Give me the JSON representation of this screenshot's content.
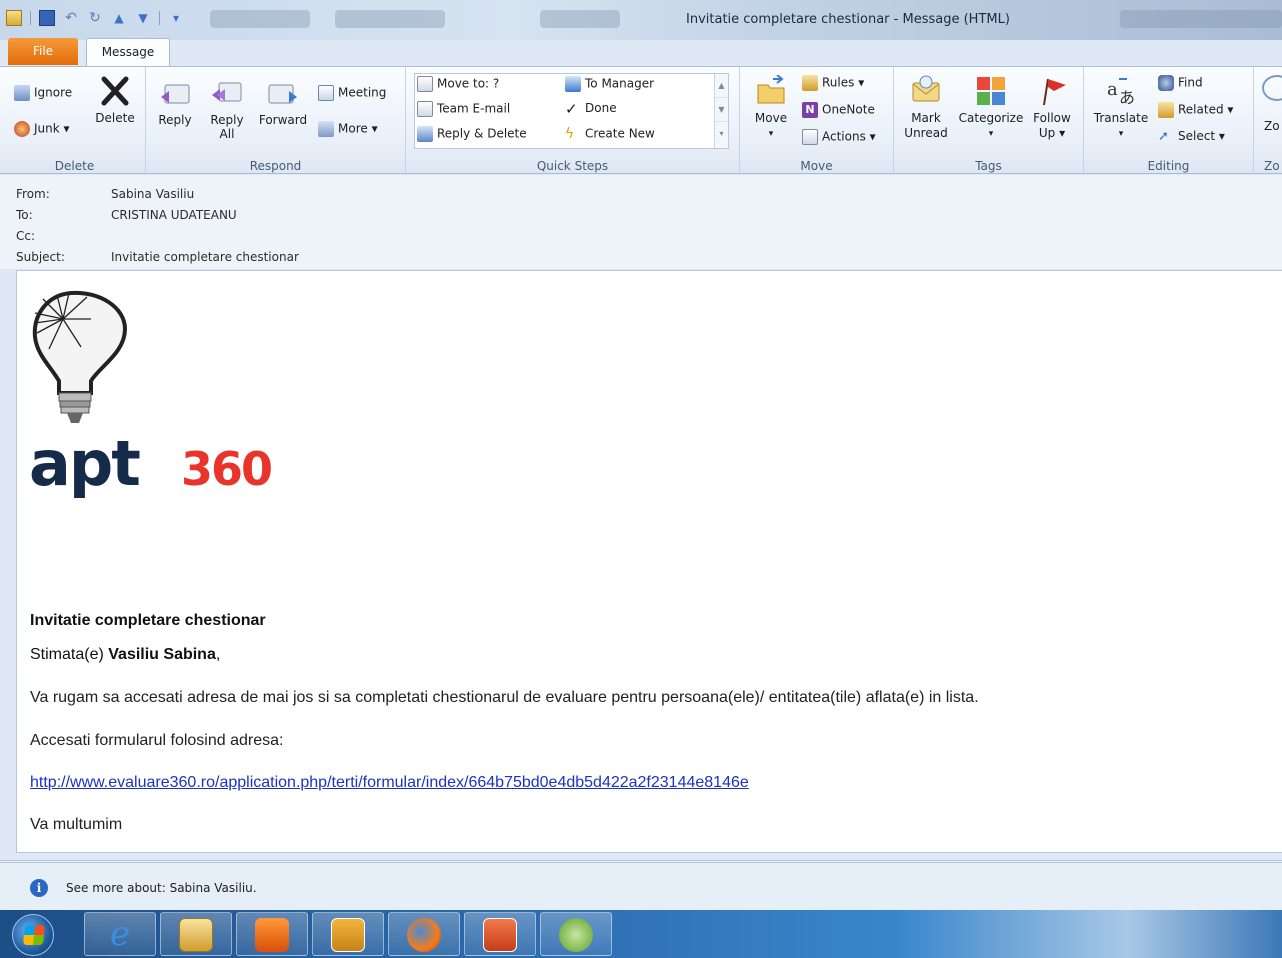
{
  "window": {
    "title": "Invitatie completare chestionar  -  Message (HTML)"
  },
  "tabs": {
    "file": "File",
    "message": "Message"
  },
  "ribbon": {
    "delete_group": {
      "label": "Delete",
      "ignore": "Ignore",
      "junk": "Junk",
      "delete": "Delete"
    },
    "respond_group": {
      "label": "Respond",
      "reply": "Reply",
      "reply_all_line1": "Reply",
      "reply_all_line2": "All",
      "forward": "Forward",
      "meeting": "Meeting",
      "more": "More"
    },
    "quick_steps_group": {
      "label": "Quick Steps",
      "move_to": "Move to: ?",
      "team_email": "Team E-mail",
      "reply_delete": "Reply & Delete",
      "to_manager": "To Manager",
      "done": "Done",
      "create_new": "Create New"
    },
    "move_group": {
      "label": "Move",
      "move": "Move",
      "rules": "Rules",
      "onenote": "OneNote",
      "actions": "Actions"
    },
    "tags_group": {
      "label": "Tags",
      "mark_unread_line1": "Mark",
      "mark_unread_line2": "Unread",
      "categorize": "Categorize",
      "follow_up_line1": "Follow",
      "follow_up_line2": "Up"
    },
    "editing_group": {
      "label": "Editing",
      "translate": "Translate",
      "find": "Find",
      "related": "Related",
      "select": "Select"
    },
    "zoom_group": {
      "label": "Zo",
      "zoom": "Zo"
    }
  },
  "header": {
    "from_label": "From:",
    "from_value": "Sabina Vasiliu",
    "to_label": "To:",
    "to_value": "CRISTINA UDATEANU",
    "cc_label": "Cc:",
    "cc_value": "",
    "subject_label": "Subject:",
    "subject_value": "Invitatie completare chestionar"
  },
  "message": {
    "logo_text_dark": "apt",
    "logo_text_red": "360",
    "title": "Invitatie completare chestionar",
    "greeting_prefix": "Stimata(e) ",
    "greeting_name": "Vasiliu Sabina",
    "greeting_suffix": ",",
    "paragraph1": "Va rugam sa accesati adresa de mai jos si sa completati chestionarul de evaluare pentru persoana(ele)/ entitatea(tile) aflata(e) in lista.",
    "paragraph2": "Accesati formularul folosind adresa:",
    "link": "http://www.evaluare360.ro/application.php/terti/formular/index/664b75bd0e4db5d422a2f23144e8146e",
    "closing": "Va multumim"
  },
  "people_pane": {
    "text": "See more about: Sabina Vasiliu."
  },
  "colors": {
    "accent_file_tab": "#e46c0a",
    "logo_dark": "#162a4a",
    "logo_red": "#e8342a",
    "link": "#1a32c8"
  },
  "taskbar": {
    "items": [
      "start-icon",
      "internet-explorer-icon",
      "file-explorer-icon",
      "media-player-icon",
      "outlook-icon",
      "firefox-icon",
      "powerpoint-icon",
      "greenshot-icon"
    ]
  }
}
